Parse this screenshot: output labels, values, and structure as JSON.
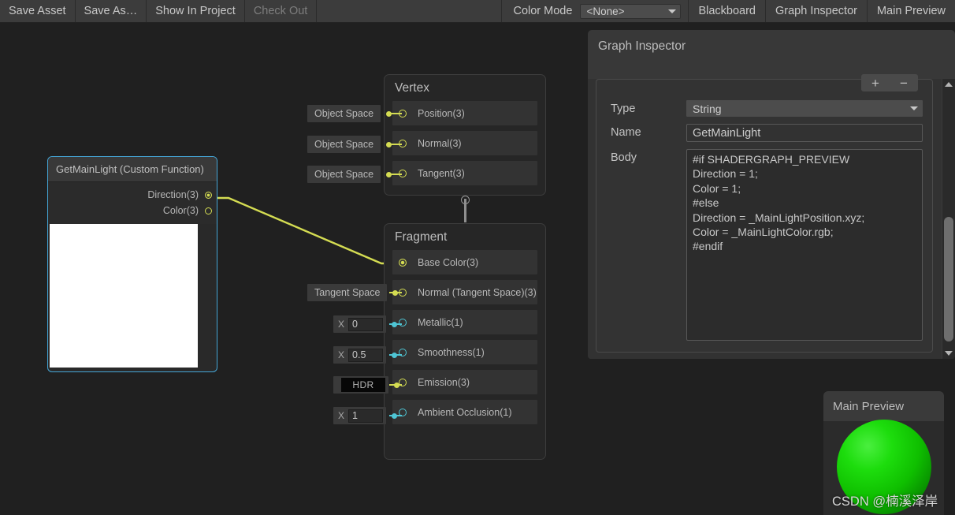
{
  "toolbar": {
    "buttons": [
      {
        "label": "Save Asset",
        "disabled": false
      },
      {
        "label": "Save As…",
        "disabled": false
      },
      {
        "label": "Show In Project",
        "disabled": false
      },
      {
        "label": "Check Out",
        "disabled": true
      }
    ],
    "color_mode_label": "Color Mode",
    "color_mode_value": "<None>",
    "toggles": [
      {
        "label": "Blackboard"
      },
      {
        "label": "Graph Inspector"
      },
      {
        "label": "Main Preview"
      }
    ]
  },
  "custom_function_node": {
    "title": "GetMainLight (Custom Function)",
    "ports": [
      {
        "label": "Direction(3)",
        "connected": true
      },
      {
        "label": "Color(3)",
        "connected": false
      }
    ],
    "selection_color": "#44a5d6"
  },
  "vertex_block": {
    "title": "Vertex",
    "rows": [
      {
        "label": "Position(3)",
        "slot": "Object Space",
        "slot_type": "chip",
        "port_color": "#d4dc52"
      },
      {
        "label": "Normal(3)",
        "slot": "Object Space",
        "slot_type": "chip",
        "port_color": "#d4dc52"
      },
      {
        "label": "Tangent(3)",
        "slot": "Object Space",
        "slot_type": "chip",
        "port_color": "#d4dc52"
      }
    ]
  },
  "fragment_block": {
    "title": "Fragment",
    "rows": [
      {
        "label": "Base Color(3)",
        "slot": "",
        "slot_type": "none",
        "port_color": "#d4dc52",
        "connected": true
      },
      {
        "label": "Normal (Tangent Space)(3)",
        "slot": "Tangent Space",
        "slot_type": "chip",
        "port_color": "#d4dc52"
      },
      {
        "label": "Metallic(1)",
        "slot": "0",
        "slot_axis": "X",
        "slot_type": "number",
        "port_color": "#4ec5d4"
      },
      {
        "label": "Smoothness(1)",
        "slot": "0.5",
        "slot_axis": "X",
        "slot_type": "number",
        "port_color": "#4ec5d4"
      },
      {
        "label": "Emission(3)",
        "slot": "HDR",
        "slot_type": "hdr",
        "port_color": "#d4dc52"
      },
      {
        "label": "Ambient Occlusion(1)",
        "slot": "1",
        "slot_axis": "X",
        "slot_type": "number",
        "port_color": "#4ec5d4"
      }
    ]
  },
  "inspector": {
    "title": "Graph Inspector",
    "add_label": "+",
    "remove_label": "−",
    "fields": {
      "type_label": "Type",
      "type_value": "String",
      "name_label": "Name",
      "name_value": "GetMainLight",
      "body_label": "Body",
      "body_value": "#if SHADERGRAPH_PREVIEW\nDirection = 1;\nColor = 1;\n#else\nDirection = _MainLightPosition.xyz;\nColor = _MainLightColor.rgb;\n#endif"
    }
  },
  "main_preview": {
    "title": "Main Preview",
    "sphere_color": "#12d400"
  },
  "watermark": "CSDN @楠溪泽岸"
}
